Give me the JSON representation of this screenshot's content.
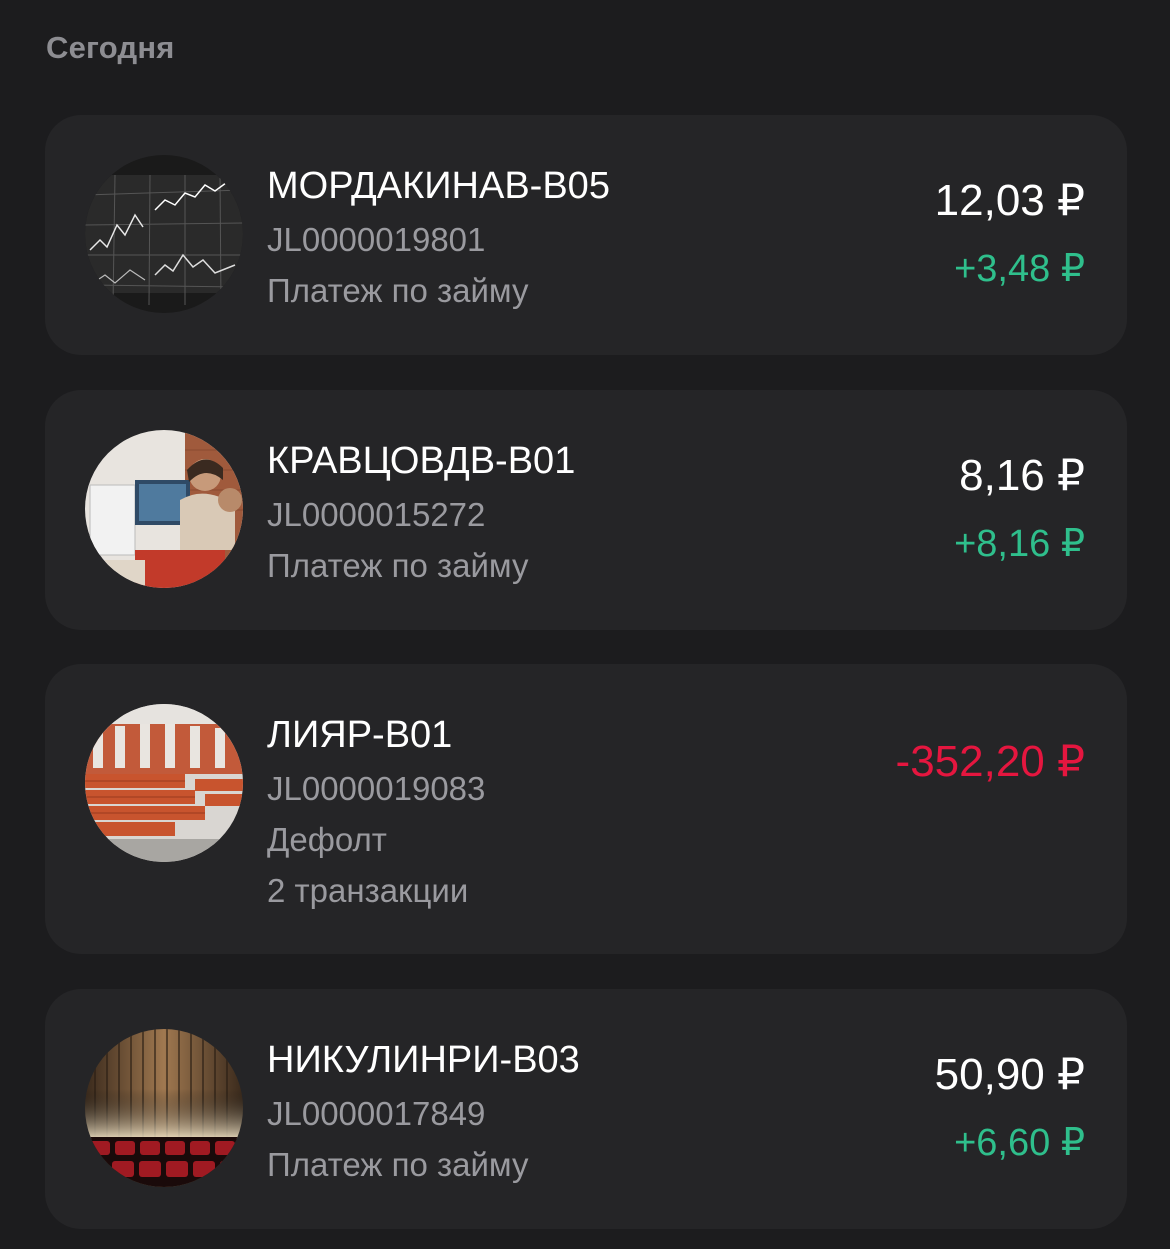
{
  "section": {
    "title": "Сегодня"
  },
  "colors": {
    "background": "#1c1c1e",
    "card": "#252527",
    "positive": "#2fbf8c",
    "negative": "#e5163f",
    "secondary_text": "#9a9a9f"
  },
  "transactions": [
    {
      "name": "МОРДАКИНАВ-В05",
      "id": "JL0000019801",
      "type": "Платеж по займу",
      "amount": "12,03 ₽",
      "delta": "+3,48 ₽",
      "avatar": "stock-chart-photo"
    },
    {
      "name": "КРАВЦОВДВ-В01",
      "id": "JL0000015272",
      "type": "Платеж по займу",
      "amount": "8,16 ₽",
      "delta": "+8,16 ₽",
      "avatar": "office-workers-photo"
    },
    {
      "name": "ЛИЯР-В01",
      "id": "JL0000019083",
      "type": "Дефолт",
      "extra": "2 транзакции",
      "amount": "-352,20 ₽",
      "avatar": "warehouse-bricks-photo"
    },
    {
      "name": "НИКУЛИНРИ-В03",
      "id": "JL0000017849",
      "type": "Платеж по займу",
      "amount": "50,90 ₽",
      "delta": "+6,60 ₽",
      "avatar": "theater-curtain-photo"
    }
  ]
}
